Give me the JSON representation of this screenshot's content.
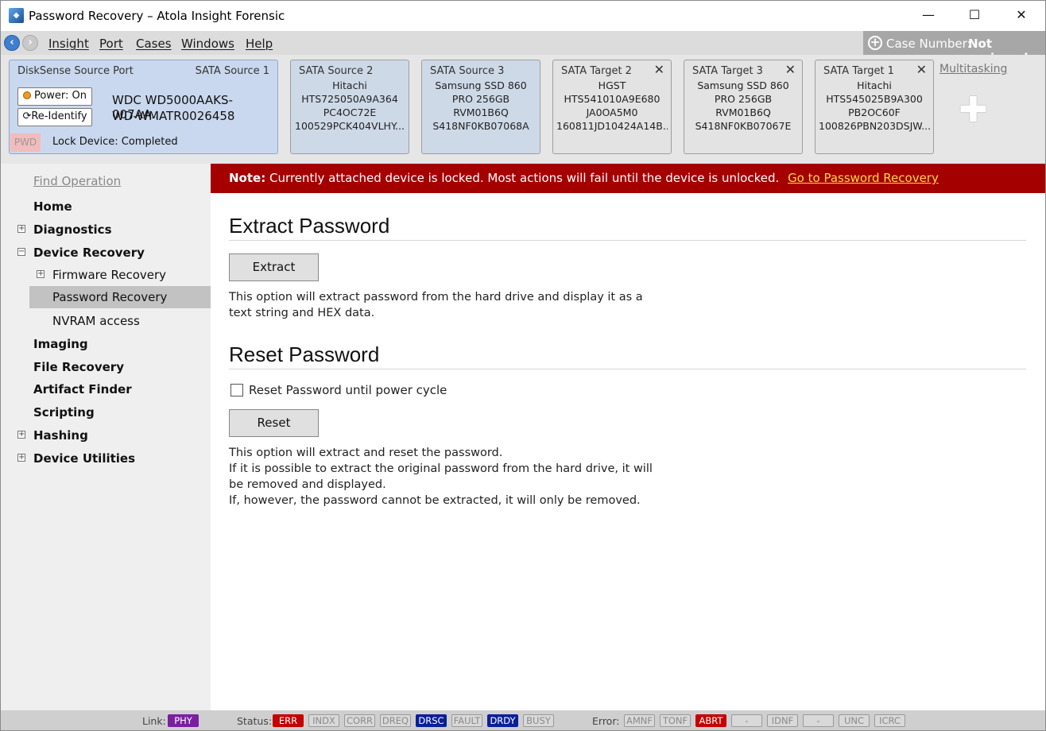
{
  "window": {
    "title": "Password Recovery – Atola Insight Forensic"
  },
  "menu": {
    "items": [
      "Insight",
      "Port",
      "Cases",
      "Windows",
      "Help"
    ]
  },
  "case": {
    "label": "Case Number:",
    "value": "Not assigned"
  },
  "source_port": {
    "title": "DiskSense Source Port",
    "port": "SATA Source 1",
    "power_label": "Power: On",
    "reidentify_label": "Re-Identify",
    "model": "WDC WD5000AAKS-007AA...",
    "serial": "WD-WMATR0026458",
    "pwd_badge": "PWD",
    "lock_status": "Lock Device: Completed"
  },
  "ports": [
    {
      "name": "SATA Source 2",
      "lines": [
        "Hitachi",
        "HTS725050A9A364",
        "PC4OC72E",
        "100529PCK404VLHY..."
      ],
      "closable": false,
      "source": true
    },
    {
      "name": "SATA Source 3",
      "lines": [
        "Samsung SSD 860",
        "PRO 256GB",
        "RVM01B6Q",
        "S418NF0KB07068A"
      ],
      "closable": false,
      "source": true
    },
    {
      "name": "SATA Target 2",
      "lines": [
        "HGST",
        "HTS541010A9E680",
        "JA0OA5M0",
        "160811JD10424A14B..."
      ],
      "closable": true,
      "source": false
    },
    {
      "name": "SATA Target 3",
      "lines": [
        "Samsung SSD 860",
        "PRO 256GB",
        "RVM01B6Q",
        "S418NF0KB07067E"
      ],
      "closable": true,
      "source": false
    },
    {
      "name": "SATA Target 1",
      "lines": [
        "Hitachi",
        "HTS545025B9A300",
        "PB2OC60F",
        "100826PBN203DSJW..."
      ],
      "closable": true,
      "source": false
    }
  ],
  "multitasking": {
    "label": "Multitasking"
  },
  "sidebar": {
    "find": "Find Operation",
    "items": {
      "home": "Home",
      "diagnostics": "Diagnostics",
      "device_recovery": "Device Recovery",
      "firmware_recovery": "Firmware Recovery",
      "password_recovery": "Password Recovery",
      "nvram": "NVRAM access",
      "imaging": "Imaging",
      "file_recovery": "File Recovery",
      "artifact_finder": "Artifact Finder",
      "scripting": "Scripting",
      "hashing": "Hashing",
      "device_utilities": "Device Utilities"
    }
  },
  "note": {
    "prefix": "Note:",
    "text": "Currently attached device is locked. Most actions will fail until the device is unlocked.",
    "link": "Go to Password Recovery"
  },
  "extract": {
    "heading": "Extract Password",
    "button": "Extract",
    "line1": "This option will extract password from the hard drive and display it as a",
    "line2": "text string and HEX data."
  },
  "reset": {
    "heading": "Reset Password",
    "checkbox_label": "Reset Password until power cycle",
    "checkbox_checked": false,
    "button": "Reset",
    "line1": "This option will extract and reset the password.",
    "line2": "If it is possible to extract the original password from the hard drive, it will",
    "line3": "be removed and displayed.",
    "line4": "If, however, the password cannot be extracted, it will only be removed."
  },
  "statusbar": {
    "link_label": "Link:",
    "link_chip": {
      "text": "PHY",
      "color": "#7a1fa2"
    },
    "status_label": "Status:",
    "status_chips": [
      {
        "text": "ERR",
        "color": "#c40000"
      },
      {
        "text": "INDX",
        "color": ""
      },
      {
        "text": "CORR",
        "color": ""
      },
      {
        "text": "DREQ",
        "color": ""
      },
      {
        "text": "DRSC",
        "color": "#0b1f9a"
      },
      {
        "text": "FAULT",
        "color": ""
      },
      {
        "text": "DRDY",
        "color": "#0b1f9a"
      },
      {
        "text": "BUSY",
        "color": ""
      }
    ],
    "error_label": "Error:",
    "error_chips": [
      {
        "text": "AMNF",
        "color": ""
      },
      {
        "text": "TONF",
        "color": ""
      },
      {
        "text": "ABRT",
        "color": "#c40000"
      },
      {
        "text": "-",
        "color": ""
      },
      {
        "text": "IDNF",
        "color": ""
      },
      {
        "text": "-",
        "color": ""
      },
      {
        "text": "UNC",
        "color": ""
      },
      {
        "text": "ICRC",
        "color": ""
      }
    ]
  }
}
